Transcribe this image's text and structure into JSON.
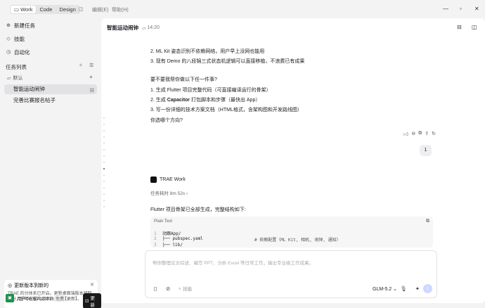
{
  "titlebar": {
    "modes": [
      {
        "label": "Work",
        "icon": "window-icon",
        "active": true
      },
      {
        "label": "Code",
        "active": false
      },
      {
        "label": "Design",
        "active": false
      }
    ],
    "menu": [
      "编辑(E)",
      "帮助(H)"
    ]
  },
  "sidebar": {
    "nav": [
      {
        "label": "新建任务",
        "icon": "new-task-icon"
      },
      {
        "label": "技能",
        "icon": "skills-icon"
      },
      {
        "label": "自动化",
        "icon": "automation-icon"
      }
    ],
    "section_title": "任务列表",
    "folder": "默认",
    "tasks": [
      "智能运动闹钟",
      "完善比赛报名帖子"
    ],
    "notice": {
      "title": "更新版本到新的",
      "body": "TRAE 的分体系已开启。更新桌面端版本领取积分，你可在窗内点下角点击【更新】。"
    },
    "user": {
      "name": "用户0005702381",
      "badge": "免费",
      "upgrade": "更新"
    }
  },
  "main": {
    "title": "智能运动闹钟",
    "time": "14:20",
    "lines_top": [
      "2. ML Kit 姿态识别不依赖网络，用户早上没网也能用",
      "3. 现有 Demo 的八段锦三式状态机逻辑可以直接移植，不浪费已有成果"
    ],
    "question": "要不要我帮你做以下任一件事?",
    "options": [
      {
        "pre": "1. 生成 ",
        "bold": "Flutter",
        "post": " 项目完整代码（可直接编译运行的骨架）"
      },
      {
        "pre": "2. 生成 ",
        "bold": "Capacitor",
        "post": " 打包脚本和步骤（最快出 App）"
      },
      {
        "pre": "3. 写一份详细的技术方案文档（HTML格式，含架构图和开发路线图）",
        "bold": "",
        "post": ""
      }
    ],
    "choose": "你选哪个方向?",
    "user_reply": "1",
    "agent_name": "TRAE Work",
    "duration": "任务耗时 8m 52s",
    "reply_intro": "Flutter 项目骨架已全部生成，完整结构如下:",
    "code": {
      "lang": "Plain Text",
      "lines": [
        {
          "n": "1",
          "text": "动跟App/",
          "comment": ""
        },
        {
          "n": "2",
          "text": "├── pubspec.yaml",
          "comment": "# 依赖配置（ML Kit, 相机, 闹钟, 通知）"
        },
        {
          "n": "3",
          "text": "├── lib/",
          "comment": ""
        }
      ]
    },
    "input": {
      "placeholder": "帮你整理论文综述、编写 PPT、分析 Excel 等日常工作，输出专业级工作成果。",
      "tool_label": "技能",
      "model": "GLM-5.2"
    }
  },
  "colors": {
    "accent": "#cfd8ff",
    "active_task_bg": "#e2e2e5",
    "avatar": "#1f8f4e"
  }
}
